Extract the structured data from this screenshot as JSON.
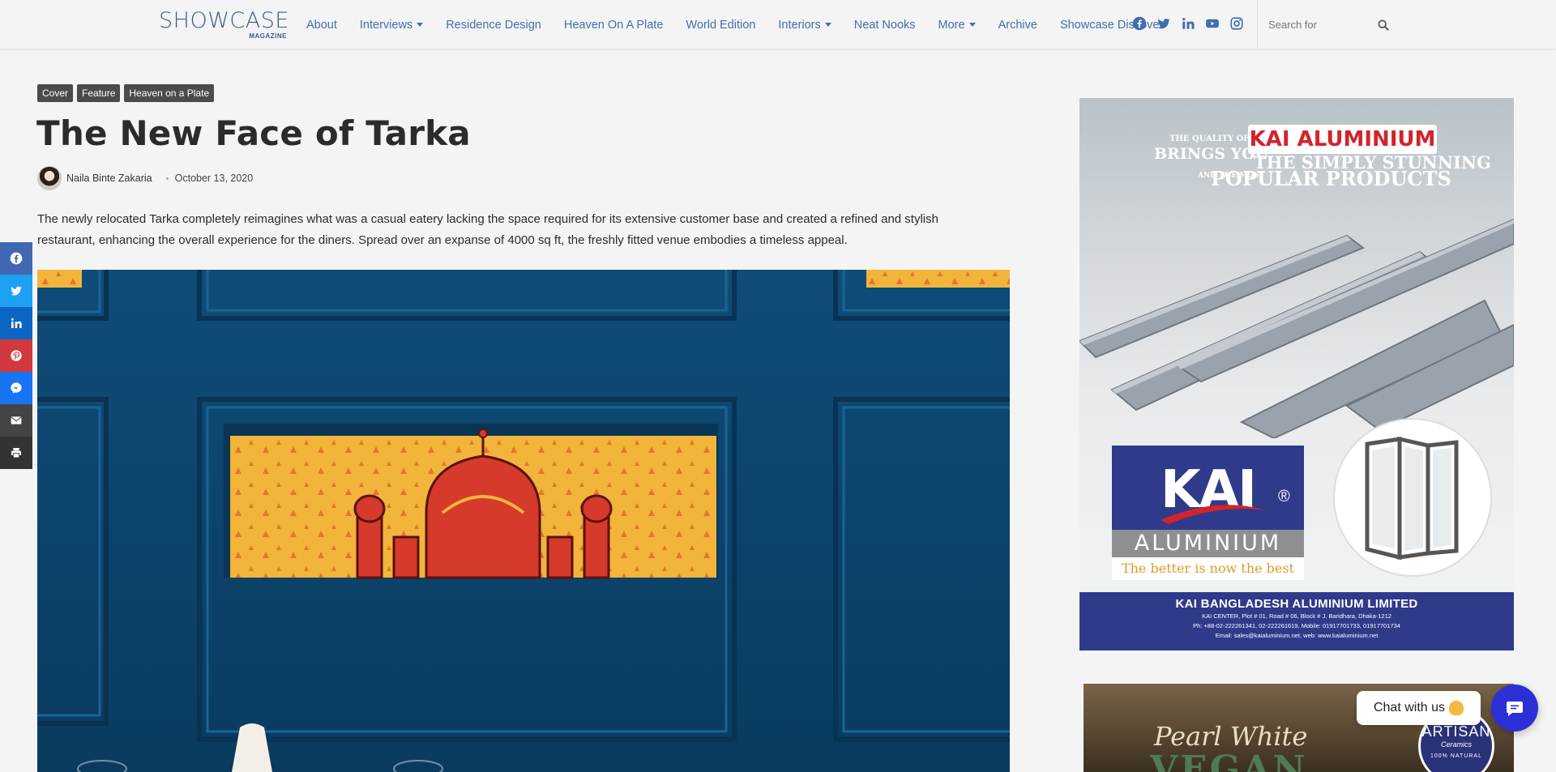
{
  "site": {
    "logo_main": "SHOWCASE",
    "logo_sub": "MAGAZINE"
  },
  "nav": {
    "items": [
      {
        "label": "About",
        "dropdown": false
      },
      {
        "label": "Interviews",
        "dropdown": true
      },
      {
        "label": "Residence Design",
        "dropdown": false
      },
      {
        "label": "Heaven On A Plate",
        "dropdown": false
      },
      {
        "label": "World Edition",
        "dropdown": false
      },
      {
        "label": "Interiors",
        "dropdown": true
      },
      {
        "label": "Neat Nooks",
        "dropdown": false
      },
      {
        "label": "More",
        "dropdown": true
      },
      {
        "label": "Archive",
        "dropdown": false
      },
      {
        "label": "Showcase Discover",
        "dropdown": false
      }
    ],
    "social_icons": [
      "facebook-icon",
      "twitter-icon",
      "linkedin-icon",
      "youtube-icon",
      "instagram-icon"
    ],
    "search_placeholder": "Search for"
  },
  "article": {
    "tags": [
      "Cover",
      "Feature",
      "Heaven on a Plate"
    ],
    "title": "The New Face of Tarka",
    "author": "Naila Binte Zakaria",
    "date": "October 13, 2020",
    "intro": "The newly relocated Tarka completely reimagines what was a casual eatery lacking the space required for its extensive customer base and created a refined and stylish restaurant, enhancing the overall experience for the diners. Spread over an expanse of 4000 sq ft, the freshly fitted venue embodies a timeless appeal."
  },
  "share_rail": [
    {
      "name": "facebook",
      "color": "#4267b2"
    },
    {
      "name": "twitter",
      "color": "#1da1f2"
    },
    {
      "name": "linkedin",
      "color": "#0a66c2"
    },
    {
      "name": "pinterest",
      "color": "#d0393e"
    },
    {
      "name": "messenger",
      "color": "#1875f2"
    },
    {
      "name": "email",
      "color": "#444444"
    },
    {
      "name": "print",
      "color": "#333333"
    }
  ],
  "ad_kai": {
    "quality": "THE QUALITY OF",
    "brings": "BRINGS YOU",
    "and_most": "AND THE MOST",
    "brand_label": "KAI ALUMINIUM",
    "stunning": "THE SIMPLY STUNNING",
    "popular": "POPULAR PRODUCTS",
    "logo_text": "KAI",
    "logo_reg": "®",
    "logo_alu": "ALUMINIUM",
    "logo_tagline": "The better is now the best",
    "company": "KAI BANGLADESH ALUMINIUM LIMITED",
    "address_1": "KAI CENTER, Plot # 01, Road # 06, Block # J, Baridhara, Dhaka-1212",
    "address_2": "Ph: +88-02-222261341, 02-222261619, Mobile: 01917701733, 01917701734",
    "address_3": "Email: sales@kaialuminium.net, web: www.kaialuminium.net"
  },
  "ad_artisan": {
    "script": "Pearl White",
    "headline": "VEGAN",
    "badge_1": "ARTISAN",
    "badge_2": "Ceramics",
    "badge_3": "100% NATURAL"
  },
  "chat": {
    "label": "Chat with us"
  },
  "colors": {
    "nav_link": "#3f6fb0",
    "tag_bg": "#4b4b4b",
    "chat_button": "#2c2fd6",
    "hero_blue": "#0d4873"
  }
}
